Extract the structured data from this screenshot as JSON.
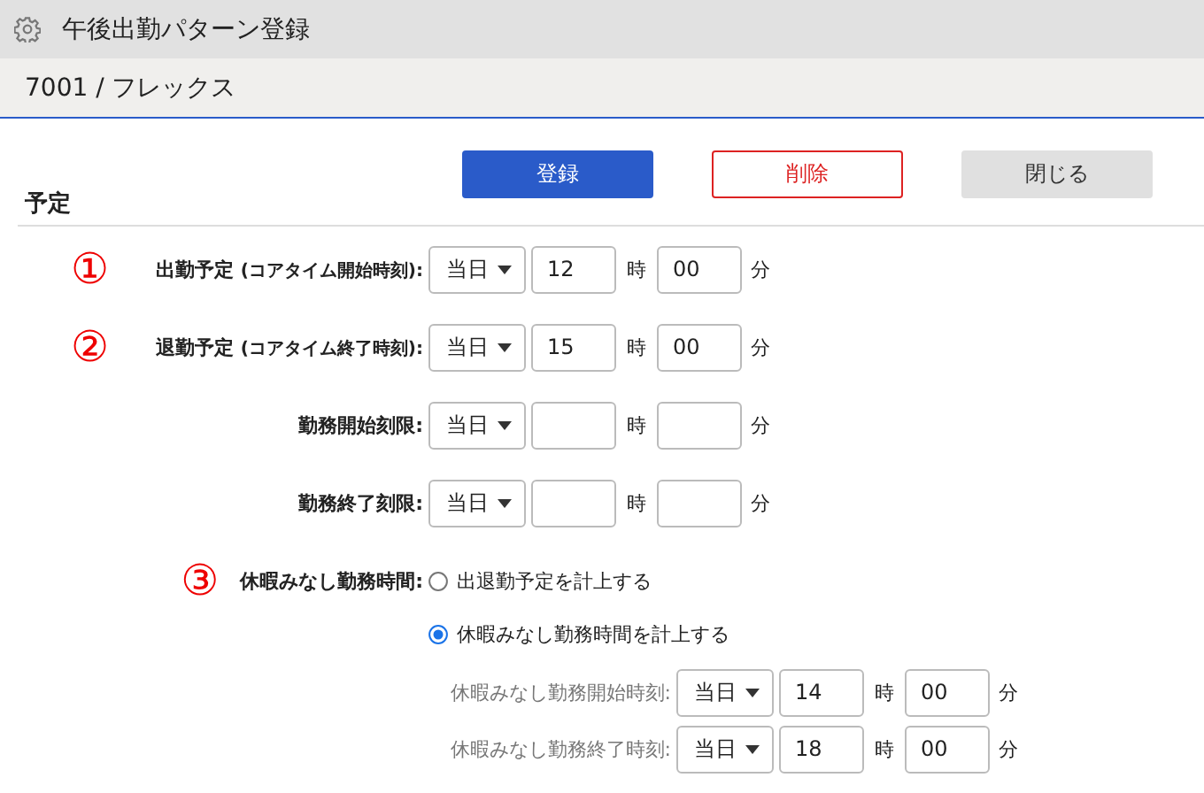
{
  "window": {
    "title": "午後出勤パターン登録"
  },
  "header": {
    "title": "7001 / フレックス"
  },
  "buttons": [
    {
      "label": "登録",
      "kind": "primary"
    },
    {
      "label": "削除",
      "kind": "danger"
    },
    {
      "label": "閉じる",
      "kind": "secondary"
    }
  ],
  "section": {
    "title": "予定"
  },
  "rows": [
    {
      "marker": "①",
      "label": "出勤予定",
      "note": "(コアタイム開始時刻):",
      "day": "当日",
      "hour": "12",
      "hour_unit": "時",
      "minute": "00",
      "minute_unit": "分"
    },
    {
      "marker": "②",
      "label": "退勤予定",
      "note": "(コアタイム終了時刻):",
      "day": "当日",
      "hour": "15",
      "hour_unit": "時",
      "minute": "00",
      "minute_unit": "分"
    },
    {
      "label": "勤務開始刻限:",
      "day": "当日",
      "hour_unit": "時",
      "minute_unit": "分"
    },
    {
      "label": "勤務終了刻限:",
      "day": "当日",
      "hour_unit": "時",
      "minute_unit": "分"
    }
  ],
  "leave": {
    "marker": "③",
    "label": "休暇みなし勤務時間:",
    "options": [
      {
        "label": "出退勤予定を計上する",
        "selected": false
      },
      {
        "label": "休暇みなし勤務時間を計上する",
        "selected": true
      }
    ],
    "rows": [
      {
        "label": "休暇みなし勤務開始時刻:",
        "day": "当日",
        "hour": "14",
        "hour_unit": "時",
        "minute": "00",
        "minute_unit": "分"
      },
      {
        "label": "休暇みなし勤務終了時刻:",
        "day": "当日",
        "hour": "18",
        "hour_unit": "時",
        "minute": "00",
        "minute_unit": "分"
      }
    ]
  }
}
